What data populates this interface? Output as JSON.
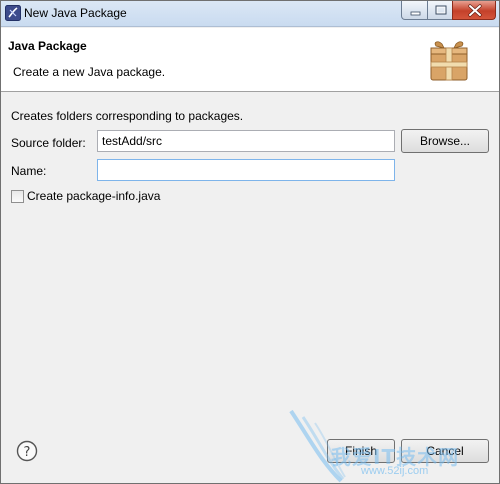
{
  "window": {
    "title": "New Java Package",
    "app_icon": "eclipse-icon"
  },
  "header": {
    "title": "Java Package",
    "description": "Create a new Java package.",
    "icon": "package-icon"
  },
  "form": {
    "intro": "Creates folders corresponding to packages.",
    "source_label": "Source folder:",
    "source_value": "testAdd/src",
    "browse_label": "Browse...",
    "name_label": "Name:",
    "name_value": "",
    "checkbox_label": "Create package-info.java",
    "checkbox_checked": false
  },
  "footer": {
    "help_icon": "help-icon",
    "finish_label": "Finish",
    "cancel_label": "Cancel"
  },
  "watermark": {
    "text": "我爱IT技术网",
    "url": "www.52ij.com"
  }
}
